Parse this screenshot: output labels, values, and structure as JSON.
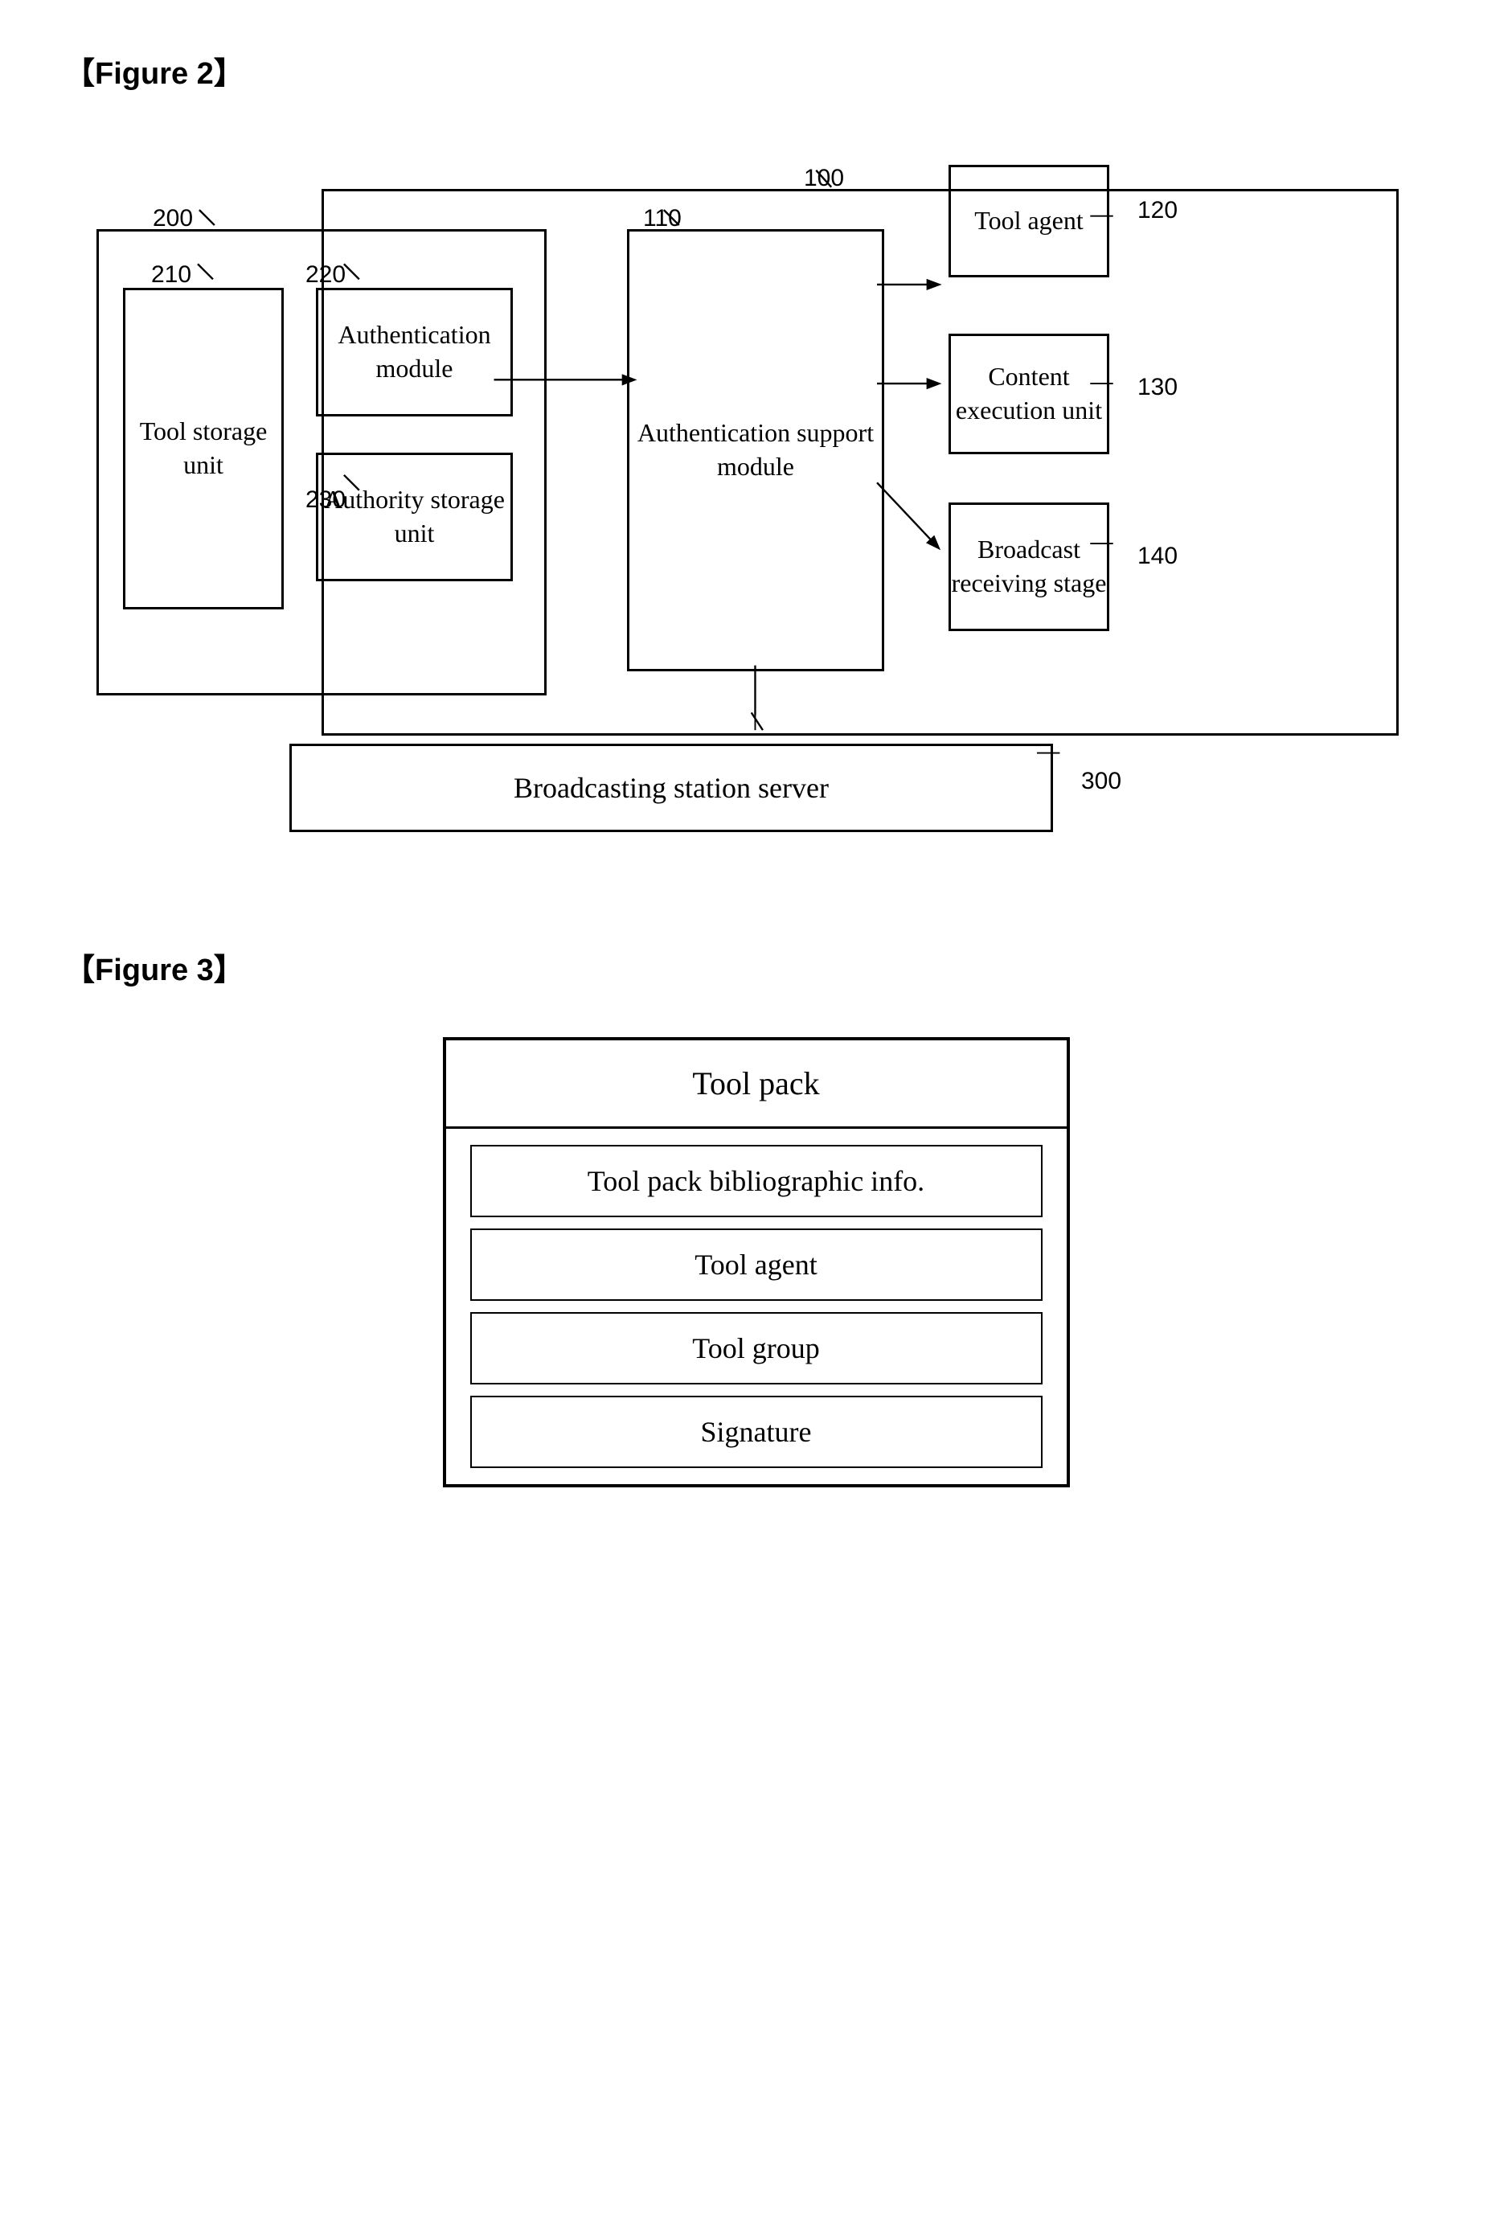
{
  "figure2": {
    "label": "【Figure 2】",
    "refs": {
      "r100": "100",
      "r200": "200",
      "r110": "110",
      "r210": "210",
      "r220": "220",
      "r230": "230",
      "r120": "120",
      "r130": "130",
      "r140": "140",
      "r300": "300"
    },
    "boxes": {
      "tool_storage_unit": "Tool\nstorage\nunit",
      "authentication_module": "Authentication\nmodule",
      "authority_storage_unit": "Authority\nstorage unit",
      "authentication_support_module": "Authentication\nsupport\nmodule",
      "tool_agent": "Tool agent",
      "content_execution_unit": "Content\nexecution\nunit",
      "broadcast_receiving_stage": "Broadcast\nreceiving\nstage",
      "broadcasting_station_server": "Broadcasting station server"
    }
  },
  "figure3": {
    "label": "【Figure 3】",
    "header": "Tool pack",
    "rows": [
      "Tool pack bibliographic info.",
      "Tool agent",
      "Tool group",
      "Signature"
    ]
  }
}
